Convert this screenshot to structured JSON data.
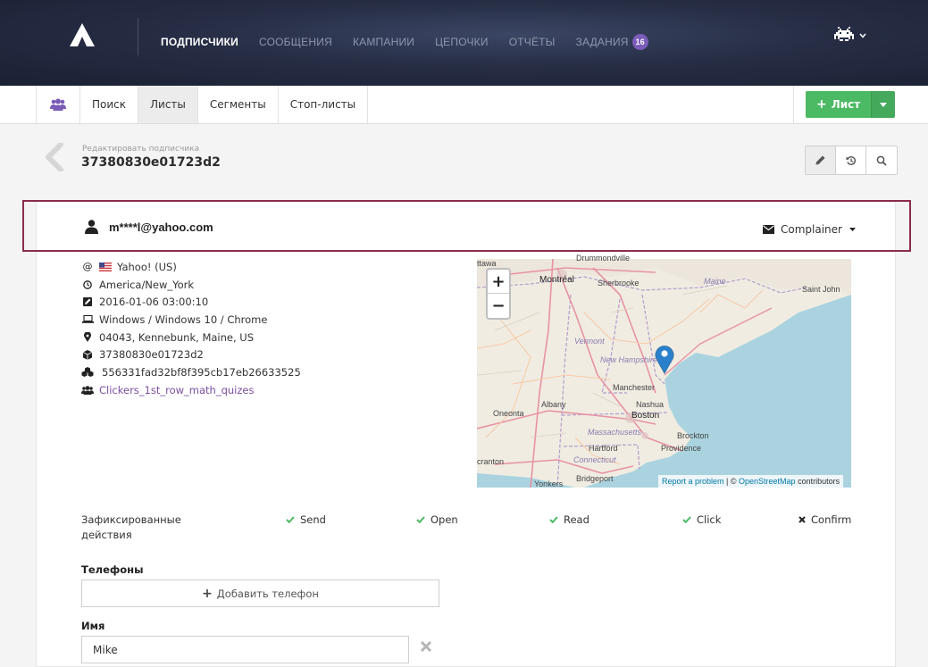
{
  "nav": {
    "items": [
      {
        "label": "ПОДПИСЧИКИ",
        "active": true
      },
      {
        "label": "СООБЩЕНИЯ",
        "active": false
      },
      {
        "label": "КАМПАНИИ",
        "active": false
      },
      {
        "label": "ЦЕПОЧКИ",
        "active": false
      },
      {
        "label": "ОТЧЁТЫ",
        "active": false
      },
      {
        "label": "ЗАДАНИЯ",
        "active": false,
        "badge": "16"
      }
    ],
    "user_icon": "space-invader-icon"
  },
  "subnav": {
    "tabs": [
      {
        "label": "Поиск",
        "active": false
      },
      {
        "label": "Листы",
        "active": true
      },
      {
        "label": "Сегменты",
        "active": false
      },
      {
        "label": "Стоп-листы",
        "active": false
      }
    ],
    "add_button": "Лист"
  },
  "header": {
    "breadcrumb": "Редактировать подписчика",
    "title": "37380830e01723d2"
  },
  "subscriber": {
    "email": "m****l@yahoo.com",
    "status": "Complainer",
    "info": [
      {
        "icon": "at-icon",
        "text": "Yahoo! (US)",
        "flag": "us-flag-icon"
      },
      {
        "icon": "clock-icon",
        "text": "America/New_York"
      },
      {
        "icon": "edit-square-icon",
        "text": "2016-01-06 03:00:10"
      },
      {
        "icon": "laptop-icon",
        "text": "Windows / Windows 10 / Chrome"
      },
      {
        "icon": "map-marker-icon",
        "text": "04043, Kennebunk, Maine, US"
      },
      {
        "icon": "cube-icon",
        "text": "37380830e01723d2"
      },
      {
        "icon": "cubes-icon",
        "text": "556331fad32bf8f395cb17eb26633525"
      },
      {
        "icon": "users-icon",
        "text": "Clickers_1st_row_math_quizes",
        "link": true
      }
    ]
  },
  "map": {
    "labels": {
      "montreal": "Montréal",
      "sherbrooke": "Sherbrooke",
      "maine": "Maine",
      "saint_john": "Saint John",
      "vermont": "Vermont",
      "new_hampshire": "New Hampshire",
      "manchester": "Manchester",
      "nashua": "Nashua",
      "albany": "Albany",
      "oneonta": "Oneonta",
      "boston": "Boston",
      "massachusetts": "Massachusetts",
      "brockton": "Brockton",
      "providence": "Providence",
      "connecticut": "Connecticut",
      "hartford": "Hartford",
      "bridgeport": "Bridgeport",
      "yonkers": "Yonkers",
      "scranton": "cranton",
      "drummondville": "Drummondville",
      "ottawa": "ttawa"
    },
    "zoom_in": "+",
    "zoom_out": "−",
    "attrib_report": "Report a problem",
    "attrib_sep": " | © ",
    "attrib_osm": "OpenStreetMap",
    "attrib_contrib": " contributors"
  },
  "actions": {
    "label": "Зафиксированные действия",
    "items": [
      {
        "label": "Send",
        "done": true
      },
      {
        "label": "Open",
        "done": true
      },
      {
        "label": "Read",
        "done": true
      },
      {
        "label": "Click",
        "done": true
      },
      {
        "label": "Confirm",
        "done": false
      }
    ]
  },
  "phones": {
    "title": "Телефоны",
    "add_label": "Добавить телефон"
  },
  "name_field": {
    "title": "Имя",
    "value": "Mike"
  },
  "colors": {
    "accent": "#7b5cb8",
    "success": "#4cb964",
    "highlight": "#8b2c4e",
    "link": "#7a4fa0"
  }
}
